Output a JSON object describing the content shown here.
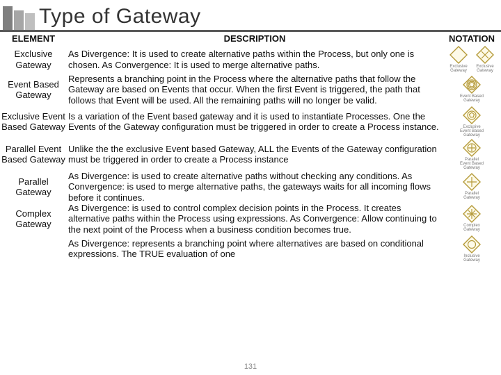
{
  "title": "Type of Gateway",
  "headers": {
    "element": "ELEMENT",
    "description": "DESCRIPTION",
    "notation": "NOTATION"
  },
  "rows": [
    {
      "element": "Exclusive Gateway",
      "description": "As Divergence: It is used to create alternative paths within the Process, but only one is chosen.\n As Convergence: It is used to merge alternative paths.",
      "icons": [
        {
          "type": "exclusive-blank",
          "caption": "Exclusive Gateway"
        },
        {
          "type": "exclusive-x",
          "caption": "Exclusive Gateway"
        }
      ]
    },
    {
      "element": "Event Based Gateway",
      "description": "Represents a branching point in the Process where the alternative paths that follow the Gateway are based on Events that occur. When the first Event is triggered, the path that follows that Event will  be used. All the remaining paths will no longer be valid.",
      "icons": [
        {
          "type": "event-based",
          "caption": "Event Based Gateway"
        }
      ]
    },
    {
      "element": "Exclusive Event Based Gateway",
      "description": "Is a variation of the Event based gateway and it is used to instantiate Processes. One the Events of the Gateway configuration must be triggered in order to create a Process instance.",
      "icons": [
        {
          "type": "event-based-single",
          "caption": "Exclusive Event Based Gateway"
        }
      ]
    },
    {
      "element": "Parallel Event Based Gateway",
      "description": "Unlike the the exclusive Event based Gateway, ALL the Events of the Gateway configuration must be triggered in order to create a Process instance",
      "icons": [
        {
          "type": "parallel-event",
          "caption": "Parallel Event Based Gateway"
        }
      ]
    },
    {
      "element": "Parallel Gateway",
      "description": "As Divergence: is used to create alternative paths without checking any conditions.\nAs Convergence: is used to merge alternative paths, the gateways waits for all incoming flows before it continues.",
      "icons": [
        {
          "type": "parallel",
          "caption": "Parallel Gateway"
        }
      ]
    },
    {
      "element": "Complex Gateway",
      "description": "As Divergence: is used to control complex decision points in the Process. It creates alternative paths within the Process using expressions.\nAs Convergence: Allow continuing to the next point of the Process when a business condition becomes true.",
      "icons": [
        {
          "type": "complex",
          "caption": "Complex Gateway"
        }
      ]
    },
    {
      "element": "",
      "description": "As Divergence: represents a branching point where alternatives are based on conditional expressions. The TRUE evaluation of one",
      "icons": [
        {
          "type": "inclusive",
          "caption": "Inclusive Gateway"
        }
      ]
    }
  ],
  "page_number": "131"
}
